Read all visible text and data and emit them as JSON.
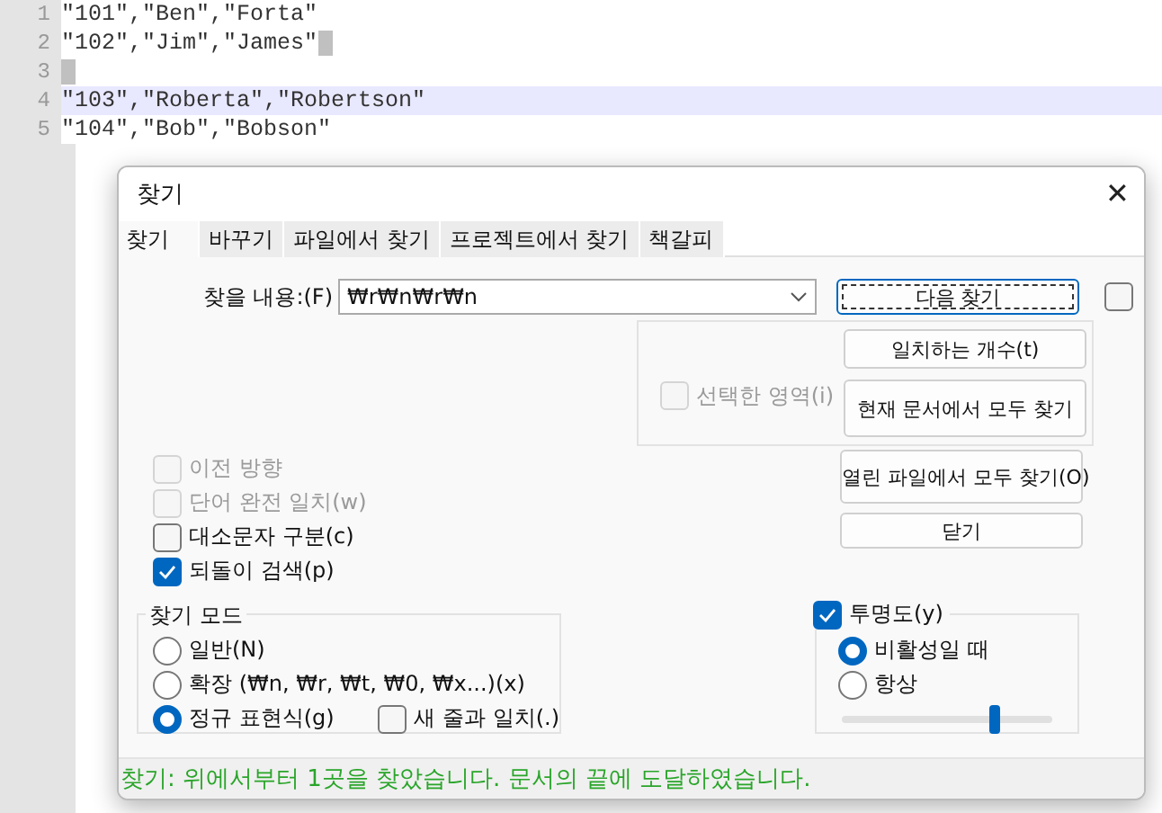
{
  "editor": {
    "lines": [
      {
        "number": "1",
        "text": "\"101\",\"Ben\",\"Forta\"",
        "selected": false,
        "end_marker": false
      },
      {
        "number": "2",
        "text": "\"102\",\"Jim\",\"James\"",
        "selected": false,
        "end_marker": true
      },
      {
        "number": "3",
        "selected": false,
        "end_marker": true
      },
      {
        "number": "4",
        "text": "\"103\",\"Roberta\",\"Robertson\"",
        "selected": true,
        "end_marker": false
      },
      {
        "number": "5",
        "text": "\"104\",\"Bob\",\"Bobson\"",
        "selected": false,
        "end_marker": false
      }
    ]
  },
  "dialog": {
    "title": "찾기",
    "close": "✕",
    "tabs": [
      {
        "label": "찾기",
        "selected": true
      },
      {
        "label": "바꾸기",
        "selected": false
      },
      {
        "label": "파일에서 찾기",
        "selected": false
      },
      {
        "label": "프로젝트에서 찾기",
        "selected": false
      },
      {
        "label": "책갈피",
        "selected": false
      }
    ],
    "find_label": "찾을 내용:(F)",
    "find_value": "₩r₩n₩r₩n",
    "find_next": {
      "label": "다음 찾기",
      "focused": true
    },
    "side_checkbox": {
      "checked": false
    },
    "selection_checkbox": {
      "label": "선택한 영역(i)",
      "checked": false,
      "disabled": true
    },
    "panel_buttons": [
      {
        "label": "일치하는 개수(t)",
        "focused": false
      },
      {
        "label": "현재 문서에서 모두 찾기",
        "focused": false
      }
    ],
    "lower_buttons": [
      {
        "label": "열린 파일에서 모두 찾기(O)",
        "focused": false
      },
      {
        "label": "닫기",
        "focused": false
      }
    ],
    "options": [
      {
        "label": "이전 방향",
        "checked": false,
        "disabled": true
      },
      {
        "label": "단어 완전 일치(w)",
        "checked": false,
        "disabled": true
      },
      {
        "label": "대소문자 구분(c)",
        "checked": false,
        "disabled": false
      },
      {
        "label": "되돌이 검색(p)",
        "checked": true,
        "disabled": false
      }
    ],
    "search_mode": {
      "title": "찾기 모드",
      "options": [
        {
          "label": "일반(N)",
          "selected": false
        },
        {
          "label": "확장 (₩n, ₩r, ₩t, ₩0, ₩x...)(x)",
          "selected": false
        },
        {
          "label": "정규 표현식(g)",
          "selected": true
        }
      ],
      "newline_checkbox": {
        "label": "새 줄과 일치(.)",
        "checked": false
      }
    },
    "transparency": {
      "label": "투명도(y)",
      "checked": true,
      "options": [
        {
          "label": "비활성일 때",
          "selected": true
        },
        {
          "label": "항상",
          "selected": false
        }
      ],
      "level": 0.73
    },
    "status": "찾기: 위에서부터 1곳을 찾았습니다. 문서의 끝에 도달하였습니다."
  }
}
